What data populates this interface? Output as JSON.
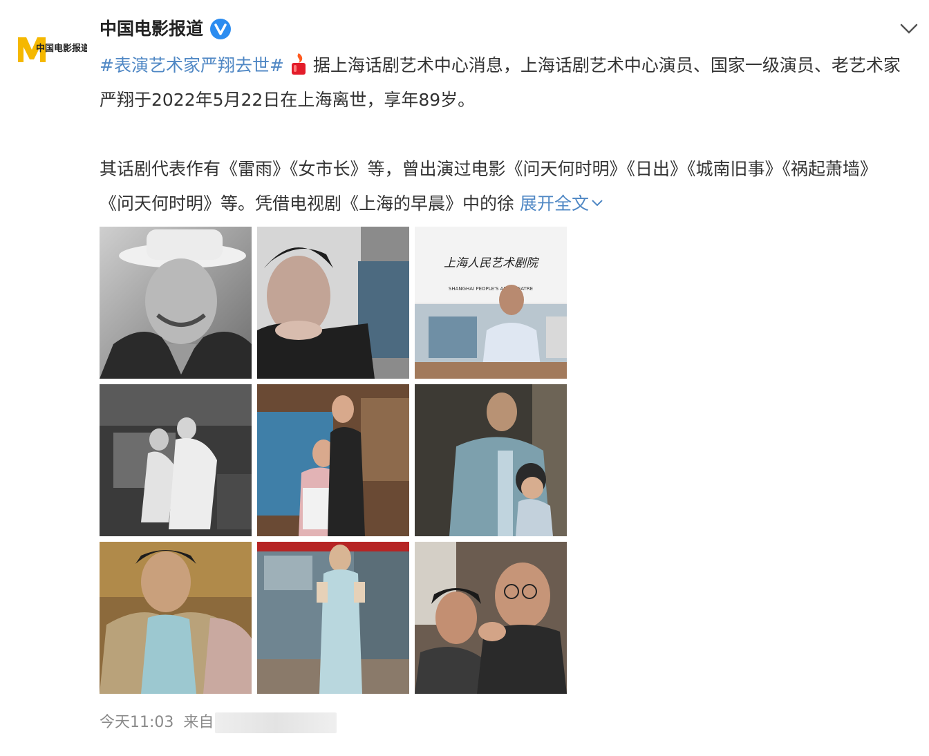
{
  "account": {
    "name": "中国电影报道",
    "avatar_logo_text": "中国电影报道 NEWS",
    "verified_icon": "verified-badge-icon"
  },
  "post": {
    "hashtag": "#表演艺术家严翔去世#",
    "text_1": "据上海话剧艺术中心消息，上海话剧艺术中心演员、国家一级演员、老艺术家严翔于2022年5月22日在上海离世，享年89岁。",
    "text_2": "其话剧代表作有《雷雨》《女市长》等，曾出演过电影《问天何时明》《日出》《城南旧事》《祸起萧墙》《问天何时明》等。凭借电视剧《上海的早晨》中的徐",
    "expand_label": "展开全文",
    "emoji": "candle-icon"
  },
  "photos": [
    {
      "name": "photo-1",
      "theme": "bw-portrait-hat"
    },
    {
      "name": "photo-2",
      "theme": "bw-portrait-hand"
    },
    {
      "name": "photo-3",
      "sign_text": "上海人民艺术剧院",
      "sign_subtext": "SHANGHAI PEOPLE'S ART THEATRE"
    },
    {
      "name": "photo-4",
      "theme": "bw-stage-scene"
    },
    {
      "name": "photo-5",
      "theme": "color-stage-couple"
    },
    {
      "name": "photo-6",
      "theme": "color-man-child"
    },
    {
      "name": "photo-7",
      "theme": "color-man-robe"
    },
    {
      "name": "photo-8",
      "theme": "color-street-scene"
    },
    {
      "name": "photo-9",
      "theme": "color-two-men"
    }
  ],
  "footer": {
    "time": "今天11:03",
    "source_prefix": "来自"
  },
  "colors": {
    "link": "#4f87c4",
    "text": "#333333",
    "meta": "#8a8a8a",
    "badge": "#2b8cf0",
    "logo_yellow": "#f5b800"
  }
}
